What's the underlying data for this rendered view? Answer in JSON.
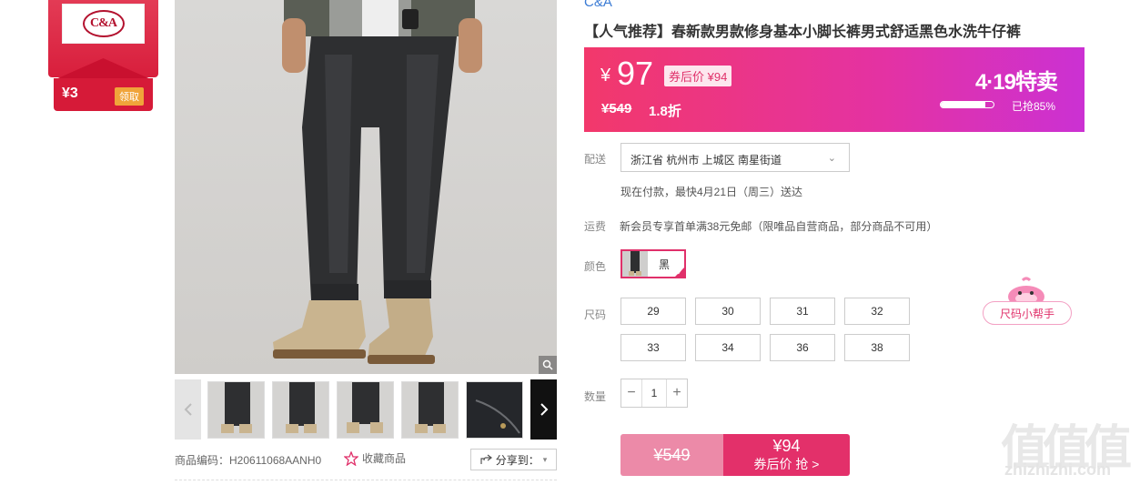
{
  "brand_coupon": {
    "logo_text": "C&A",
    "amount": "¥3",
    "claim_label": "领取"
  },
  "gallery": {
    "thumbs": [
      "thumb-1",
      "thumb-2",
      "thumb-3",
      "thumb-4",
      "thumb-5"
    ],
    "product_code": "商品编码：H20611068AANH0",
    "favorite_label": "收藏商品",
    "share_label": "分享到："
  },
  "product": {
    "brand": "C&A",
    "title": "【人气推荐】春新款男款修身基本小脚长裤男式舒适黑色水洗牛仔裤"
  },
  "price": {
    "yen_symbol": "¥",
    "current": "97",
    "coupon_price": "券后价 ¥94",
    "original": "¥549",
    "discount": "1.8折",
    "event": "4·19特卖",
    "sold_percent": 85,
    "sold_label": "已抢85%"
  },
  "shipping": {
    "label": "配送",
    "address": "浙江省 杭州市 上城区 南星街道",
    "eta": "现在付款，最快4月21日（周三）送达"
  },
  "freight": {
    "label": "运费",
    "text": "新会员专享首单满38元免邮（限唯品自营商品，部分商品不可用）"
  },
  "color": {
    "label": "颜色",
    "selected": "黑"
  },
  "size": {
    "label": "尺码",
    "options": [
      "29",
      "30",
      "31",
      "32",
      "33",
      "34",
      "36",
      "38"
    ]
  },
  "size_helper": "尺码小帮手",
  "quantity": {
    "label": "数量",
    "value": "1",
    "minus": "−",
    "plus": "+"
  },
  "buy_button": {
    "original": "¥549",
    "price": "¥94",
    "action": "券后价 抢 >"
  },
  "watermark": {
    "big": "值值值",
    "small": "zhizhizhi.com"
  }
}
